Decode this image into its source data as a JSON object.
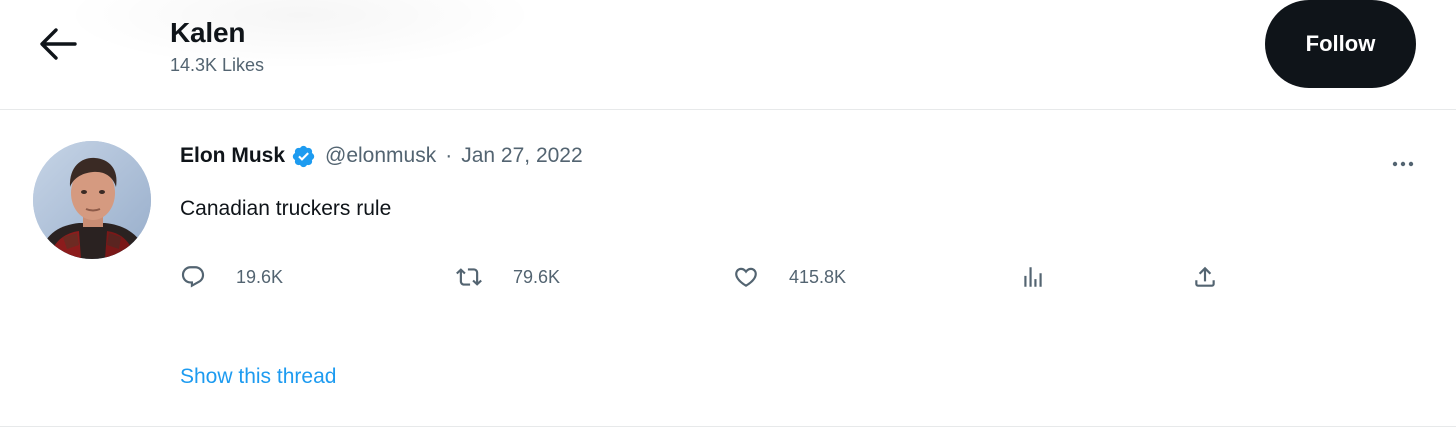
{
  "header": {
    "title": "Kalen",
    "subtitle": "14.3K Likes",
    "follow_label": "Follow"
  },
  "icons": {
    "back": "arrow-left-icon",
    "verified": "verified-badge-icon",
    "more": "more-horizontal-icon",
    "reply": "reply-icon",
    "retweet": "retweet-icon",
    "like": "heart-icon",
    "views": "analytics-icon",
    "share": "share-icon"
  },
  "colors": {
    "accent": "#1d9bf0",
    "text_primary": "#0f1419",
    "text_secondary": "#536471",
    "follow_bg": "#0f1419",
    "divider": "#e7e9ea"
  },
  "tweet": {
    "author_name": "Elon Musk",
    "handle": "@elonmusk",
    "separator": "·",
    "date": "Jan 27, 2022",
    "text": "Canadian truckers rule",
    "stats": {
      "replies": "19.6K",
      "retweets": "79.6K",
      "likes": "415.8K"
    }
  },
  "thread_link": "Show this thread"
}
